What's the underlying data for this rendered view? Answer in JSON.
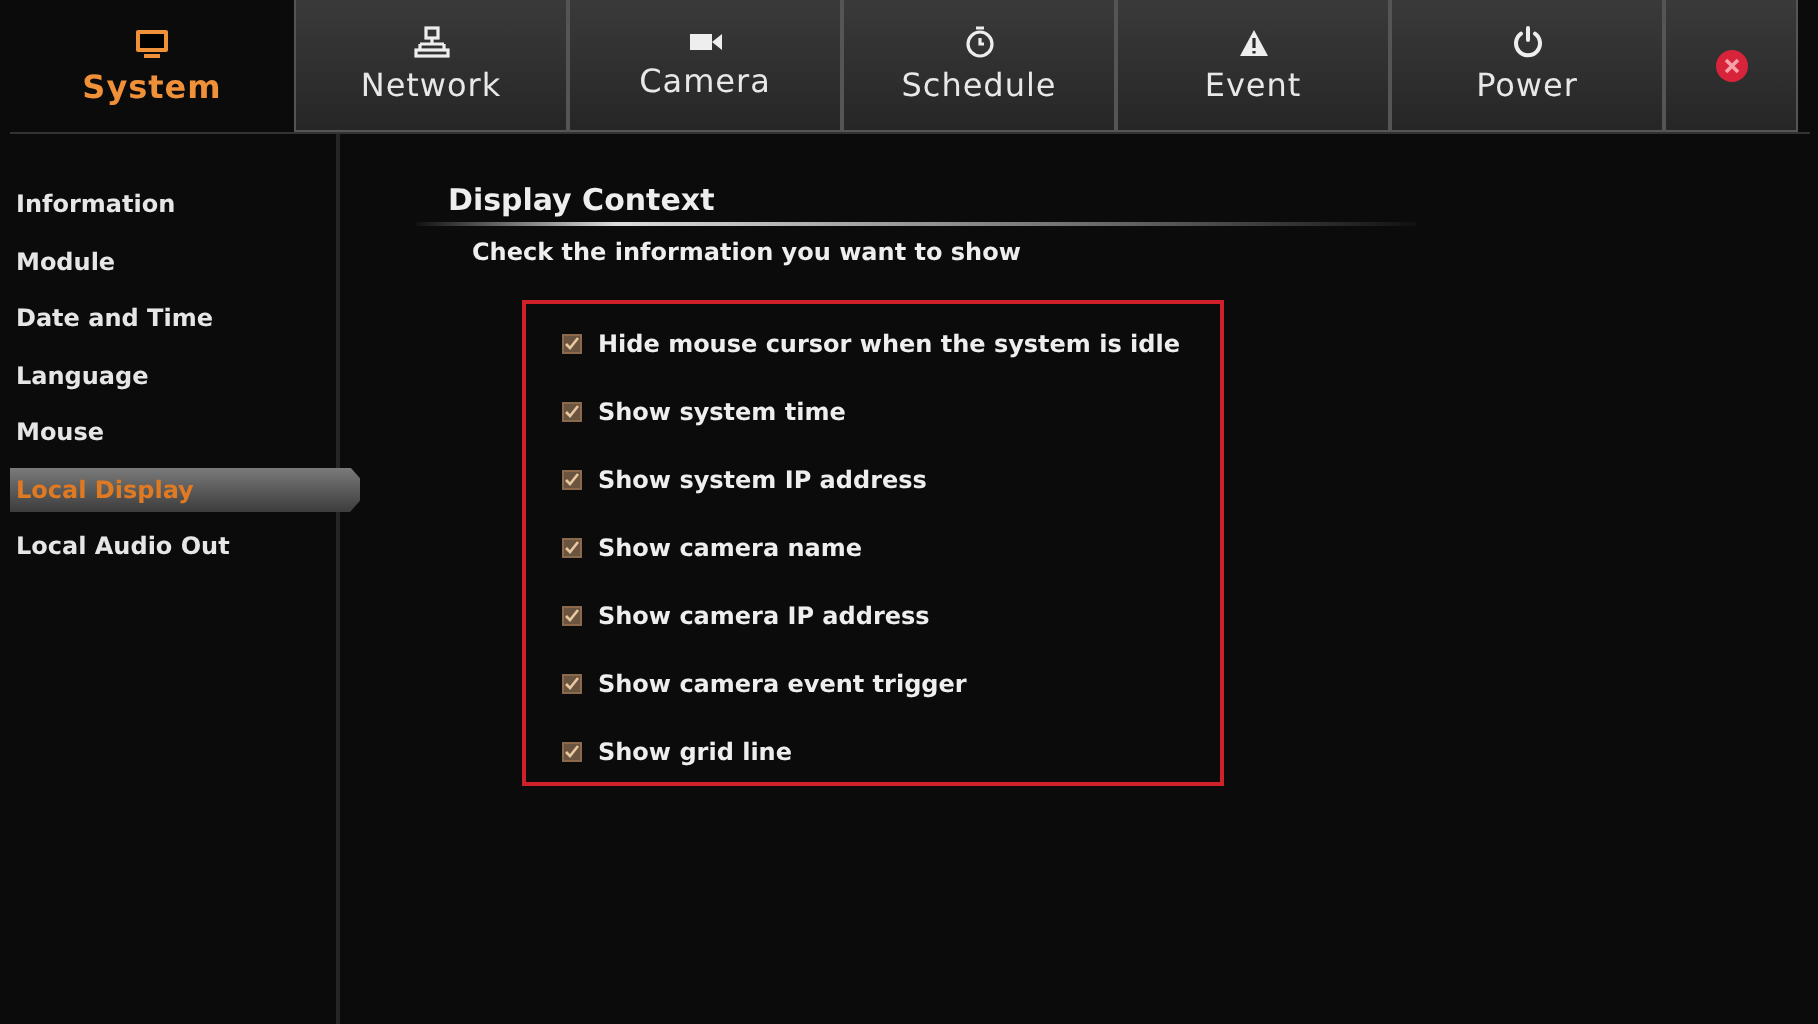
{
  "tabs": [
    {
      "kind": "system",
      "label": "System",
      "selected": true
    },
    {
      "kind": "network",
      "label": "Network",
      "selected": false
    },
    {
      "kind": "camera",
      "label": "Camera",
      "selected": false
    },
    {
      "kind": "schedule",
      "label": "Schedule",
      "selected": false
    },
    {
      "kind": "event",
      "label": "Event",
      "selected": false
    },
    {
      "kind": "power",
      "label": "Power",
      "selected": false
    },
    {
      "kind": "close",
      "selected": false
    }
  ],
  "sidebar": {
    "items": [
      {
        "label": "Information",
        "selected": false
      },
      {
        "label": "Module",
        "selected": false
      },
      {
        "label": "Date and Time",
        "selected": false
      },
      {
        "label": "Language",
        "selected": false
      },
      {
        "label": "Mouse",
        "selected": false
      },
      {
        "label": "Local Display",
        "selected": true
      },
      {
        "label": "Local Audio Out",
        "selected": false
      }
    ]
  },
  "content": {
    "title": "Display Context",
    "subtitle": "Check the information you want to show",
    "options": [
      {
        "label": "Hide mouse cursor when the system is idle",
        "checked": true
      },
      {
        "label": "Show system time",
        "checked": true
      },
      {
        "label": "Show system IP address",
        "checked": true
      },
      {
        "label": "Show camera name",
        "checked": true
      },
      {
        "label": "Show camera IP address",
        "checked": true
      },
      {
        "label": "Show camera event trigger",
        "checked": true
      },
      {
        "label": "Show grid line",
        "checked": true
      }
    ]
  }
}
